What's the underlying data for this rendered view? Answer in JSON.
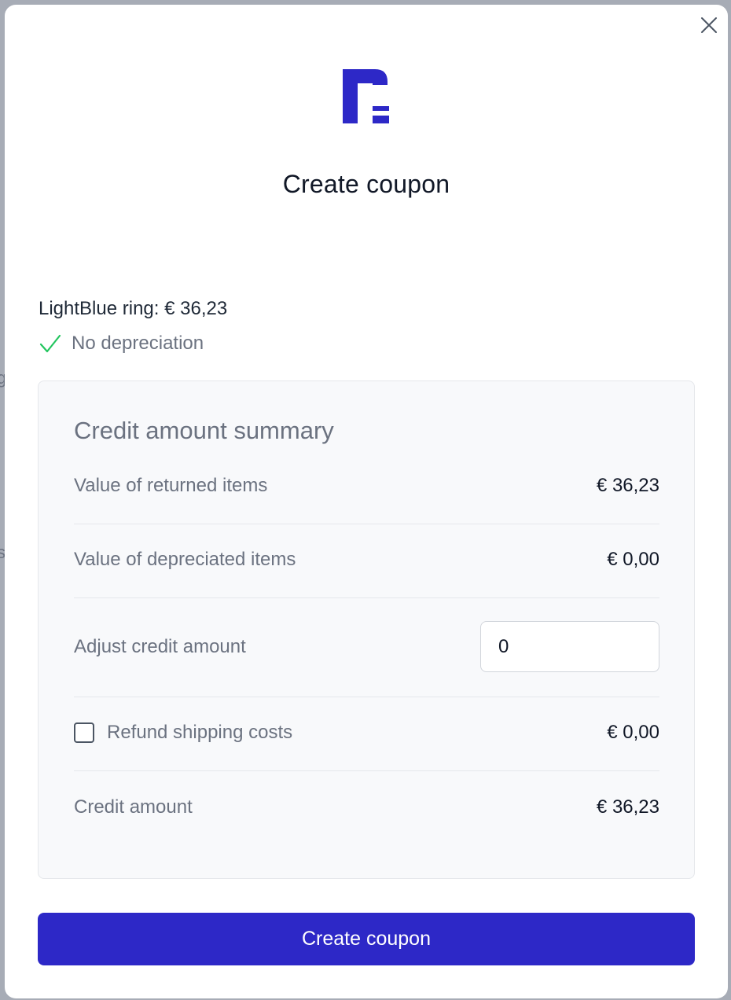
{
  "modal": {
    "title": "Create coupon",
    "close_icon": "close-icon",
    "logo_icon": "brand-logo"
  },
  "item": {
    "line": "LightBlue ring: € 36,23",
    "depreciation_status": "No depreciation",
    "status_icon": "checkmark-icon",
    "status_color": "#22c55e"
  },
  "summary": {
    "title": "Credit amount summary",
    "returned_label": "Value of returned items",
    "returned_value": "€ 36,23",
    "depreciated_label": "Value of depreciated items",
    "depreciated_value": "€ 0,00",
    "adjust_label": "Adjust credit amount",
    "adjust_value": "0",
    "refund_label": "Refund shipping costs",
    "refund_checked": false,
    "refund_value": "€ 0,00",
    "credit_label": "Credit amount",
    "credit_value": "€ 36,23"
  },
  "actions": {
    "create_label": "Create coupon",
    "primary_color": "#2d28c7"
  }
}
